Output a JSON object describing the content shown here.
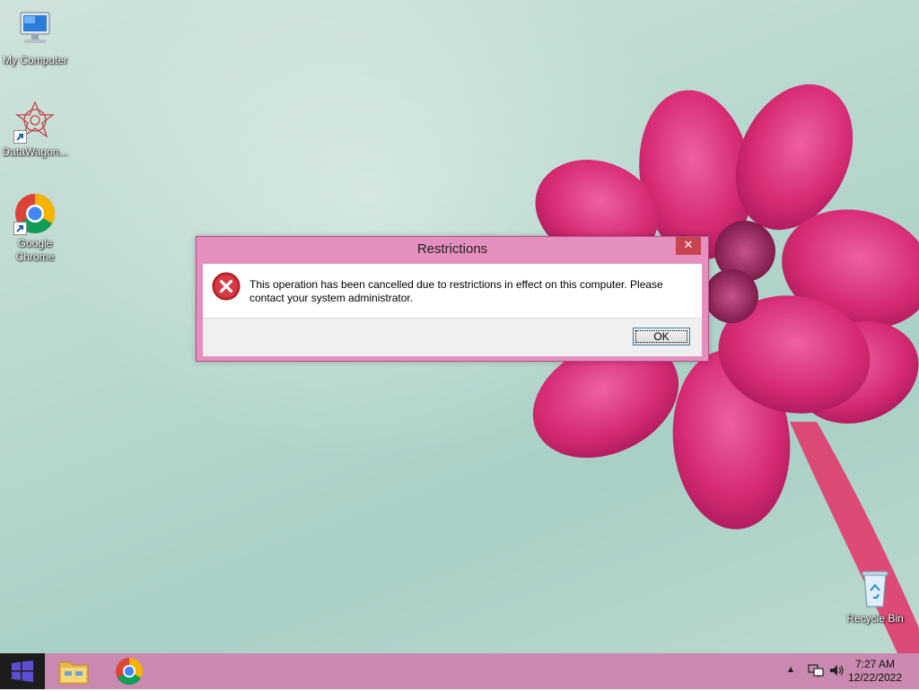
{
  "desktop": {
    "icons": [
      {
        "label": "My Computer",
        "icon": "computer-icon"
      },
      {
        "label": "DataWagon...",
        "icon": "datawagon-icon"
      },
      {
        "label": "Google Chrome",
        "icon": "chrome-icon"
      },
      {
        "label": "Recycle Bin",
        "icon": "recycle-bin-icon"
      }
    ]
  },
  "dialog": {
    "title": "Restrictions",
    "close_glyph": "✕",
    "message": "This operation has been cancelled due to restrictions in effect on this computer. Please contact your system administrator.",
    "ok_label": "OK",
    "icon": "error-icon"
  },
  "taskbar": {
    "apps": [
      {
        "name": "File Explorer",
        "icon": "file-explorer-icon"
      },
      {
        "name": "Google Chrome",
        "icon": "chrome-icon"
      }
    ],
    "tray": {
      "show_hidden_glyph": "▲",
      "time": "7:27 AM",
      "date": "12/22/2022"
    }
  },
  "colors": {
    "taskbar": "#c989b0",
    "dialog_frame": "#e58fbe",
    "close_button": "#c7434f"
  }
}
